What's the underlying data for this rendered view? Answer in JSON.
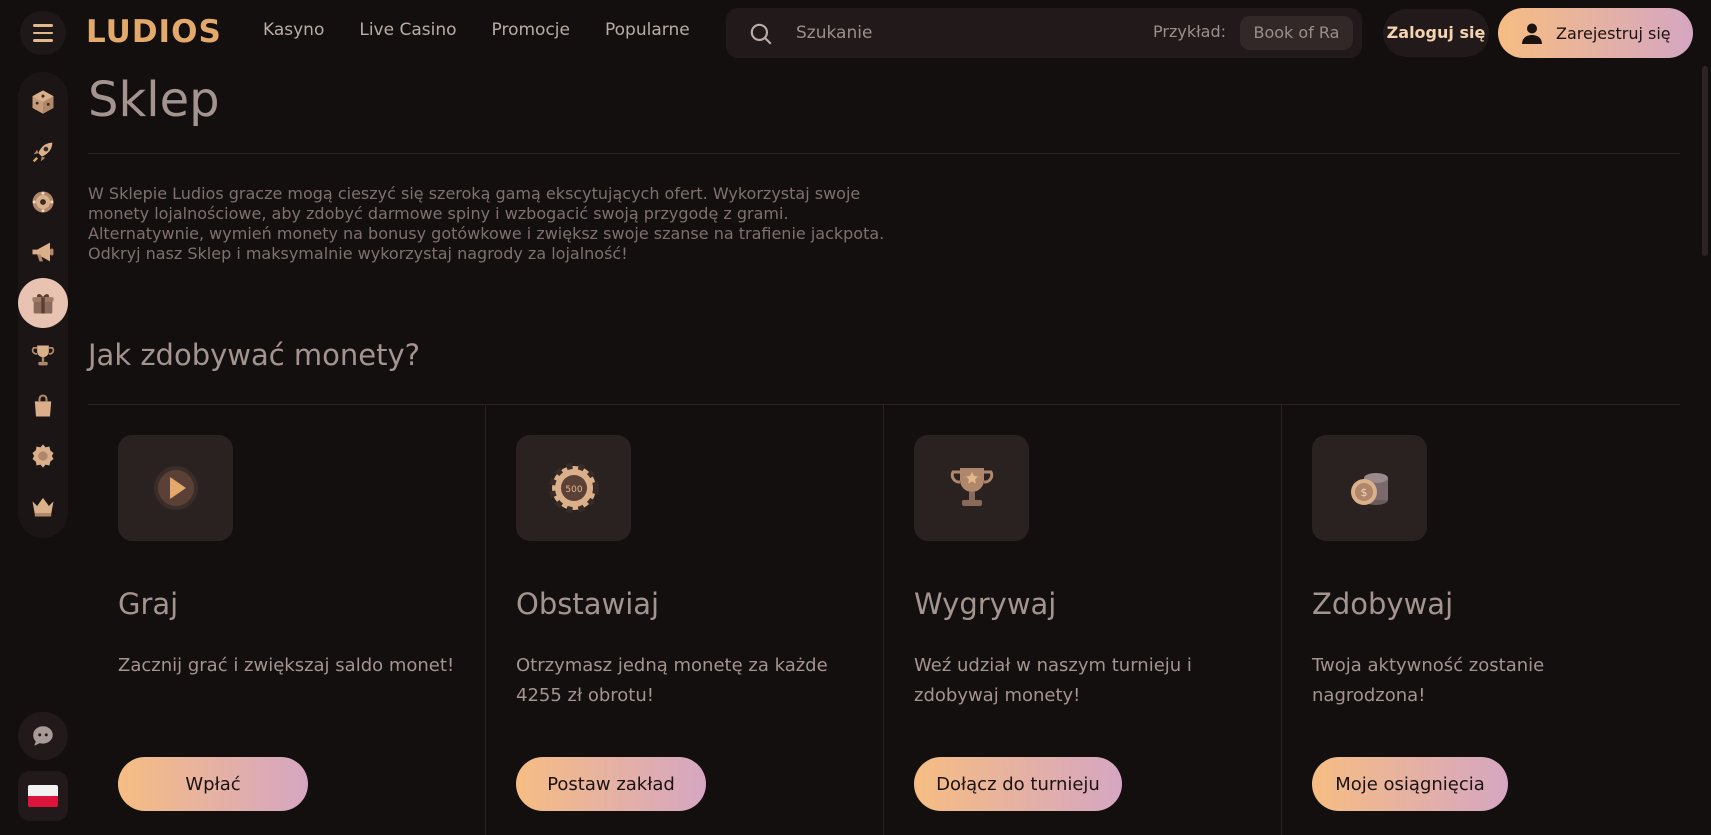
{
  "header": {
    "logo": "LUDIOS",
    "nav": [
      "Kasyno",
      "Live Casino",
      "Promocje",
      "Popularne"
    ],
    "search": {
      "placeholder": "Szukanie",
      "example_label": "Przykład:",
      "example_value": "Book of Ra"
    },
    "login_label": "Zaloguj się",
    "register_label": "Zarejestruj się"
  },
  "sidebar": {
    "items": [
      {
        "name": "dice-icon"
      },
      {
        "name": "rocket-icon"
      },
      {
        "name": "roulette-icon"
      },
      {
        "name": "megaphone-icon"
      },
      {
        "name": "gift-icon",
        "active": true
      },
      {
        "name": "trophy-icon"
      },
      {
        "name": "shopping-bag-icon"
      },
      {
        "name": "gear-badge-icon"
      },
      {
        "name": "crown-icon"
      }
    ],
    "bottom": [
      "chat-icon",
      "poland-flag-icon"
    ]
  },
  "main": {
    "title": "Sklep",
    "intro": "W Sklepie Ludios gracze mogą cieszyć się szeroką gamą ekscytujących ofert. Wykorzystaj swoje monety lojalnościowe, aby zdobyć darmowe spiny i wzbogacić swoją przygodę z grami. Alternatywnie, wymień monety na bonusy gotówkowe i zwiększ swoje szanse na trafienie jackpota. Odkryj nasz Sklep i maksymalnie wykorzystaj nagrody za lojalność!",
    "section_title": "Jak zdobywać monety?",
    "cards": [
      {
        "icon": "play-icon",
        "title": "Graj",
        "text": "Zacznij grać i zwiększaj saldo monet!",
        "button": "Wpłać"
      },
      {
        "icon": "chip-icon",
        "title": "Obstawiaj",
        "text": "Otrzymasz jedną monetę za każde 4255 zł obrotu!",
        "button": "Postaw zakład"
      },
      {
        "icon": "trophy-icon",
        "title": "Wygrywaj",
        "text": "Weź udział w naszym turnieju i zdobywaj monety!",
        "button": "Dołącz do turnieju"
      },
      {
        "icon": "coins-icon",
        "title": "Zdobywaj",
        "text": "Twoja aktywność zostanie nagrodzona!",
        "button": "Moje osiągnięcia"
      }
    ]
  },
  "colors": {
    "background": "#140f0f",
    "accent_start": "#f6bd82",
    "accent_end": "#d5a6c2",
    "logo": "#e2a96a"
  }
}
